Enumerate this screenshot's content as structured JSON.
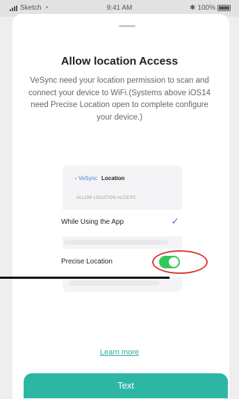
{
  "status_bar": {
    "carrier": "Sketch",
    "time": "9:41 AM",
    "battery": "100%",
    "icons": [
      "signal-icon",
      "wifi-icon",
      "bluetooth-icon",
      "battery-icon"
    ]
  },
  "dialog": {
    "title": "Allow location Access",
    "description": "VeSync need your location permission to scan and connect your device to WiFi.(Systems above iOS14 need Precise Location open to complete configure your device.)"
  },
  "illustration": {
    "back_label": "VeSync",
    "nav_title": "Location",
    "section_header": "ALLOW LOCATION ACCESS",
    "while_using_label": "While Using the App",
    "while_using_selected": true,
    "precise_label": "Precise Location",
    "precise_enabled": true
  },
  "footer": {
    "learn_more": "Learn more",
    "button_label": "Text"
  },
  "colors": {
    "accent": "#2eb6a5",
    "toggle_on": "#34c759",
    "highlight": "#d9362b",
    "link": "#2aaa9a"
  }
}
